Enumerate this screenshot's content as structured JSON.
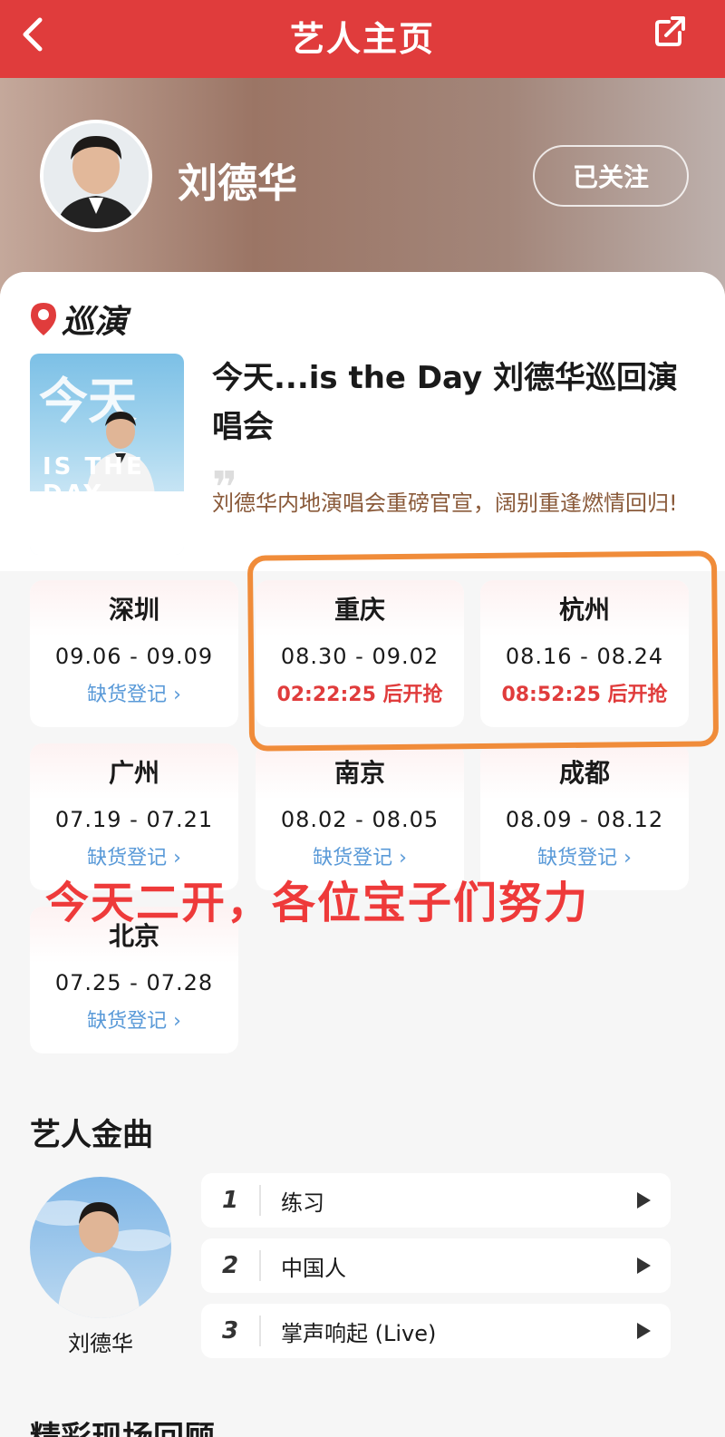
{
  "topbar": {
    "title": "艺人主页"
  },
  "artist": {
    "name": "刘德华",
    "follow_label": "已关注"
  },
  "tour": {
    "section_label": "巡演",
    "poster": {
      "big_text": "今天",
      "subtext": "IS THE DAY"
    },
    "title": "今天...is the Day 刘德华巡回演唱会",
    "subtitle": "刘德华内地演唱会重磅官宣，阔别重逢燃情回归!",
    "cities": [
      {
        "city": "深圳",
        "dates": "09.06 - 09.09",
        "status": "缺货登记 ›",
        "highlight": false
      },
      {
        "city": "重庆",
        "dates": "08.30 - 09.02",
        "status": "02:22:25 后开抢",
        "highlight": true
      },
      {
        "city": "杭州",
        "dates": "08.16 - 08.24",
        "status": "08:52:25 后开抢",
        "highlight": true
      },
      {
        "city": "广州",
        "dates": "07.19 - 07.21",
        "status": "缺货登记 ›",
        "highlight": false
      },
      {
        "city": "南京",
        "dates": "08.02 - 08.05",
        "status": "缺货登记 ›",
        "highlight": false
      },
      {
        "city": "成都",
        "dates": "08.09 - 08.12",
        "status": "缺货登记 ›",
        "highlight": false
      },
      {
        "city": "北京",
        "dates": "07.25 - 07.28",
        "status": "缺货登记 ›",
        "highlight": false
      }
    ]
  },
  "annotation": {
    "text": "今天二开，各位宝子们努力",
    "color": "#ee3a3a",
    "box_color": "#f08c3a"
  },
  "songs": {
    "section_title": "艺人金曲",
    "artist_label": "刘德华",
    "items": [
      {
        "num": "1",
        "name": "练习"
      },
      {
        "num": "2",
        "name": "中国人"
      },
      {
        "num": "3",
        "name": "掌声响起 (Live)"
      }
    ]
  },
  "next_section": {
    "title": "精彩现场回顾"
  },
  "colors": {
    "brand": "#e03c3c",
    "link": "#5a9ad8"
  }
}
